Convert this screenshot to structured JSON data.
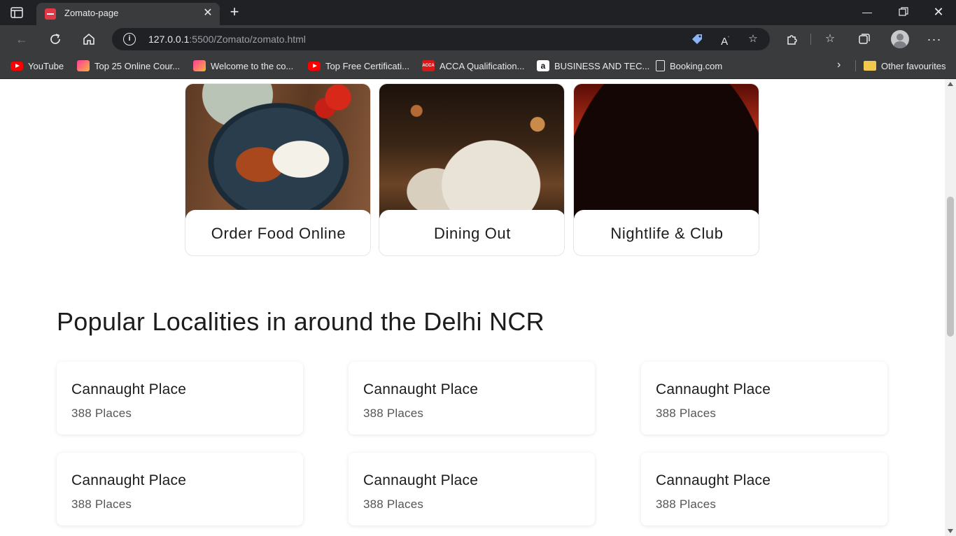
{
  "browser": {
    "tab": {
      "title": "Zomato-page"
    },
    "address": {
      "host": "127.0.0.1",
      "path": ":5500/Zomato/zomato.html"
    },
    "bookmarks": [
      {
        "label": "YouTube",
        "icon": "youtube-icon"
      },
      {
        "label": "Top 25 Online Cour...",
        "icon": "gradient-site-icon"
      },
      {
        "label": "Welcome to the co...",
        "icon": "gradient-site-icon"
      },
      {
        "label": "Top Free Certificati...",
        "icon": "youtube-icon"
      },
      {
        "label": "ACCA Qualification...",
        "icon": "acca-icon"
      },
      {
        "label": "BUSINESS AND TEC...",
        "icon": "amazon-icon"
      },
      {
        "label": "Booking.com",
        "icon": "page-icon"
      }
    ],
    "other_favourites": "Other favourites"
  },
  "icons": {
    "acca_text": "ACCA",
    "amazon_text": "a"
  },
  "page": {
    "cards": [
      {
        "label": "Order Food Online"
      },
      {
        "label": "Dining Out"
      },
      {
        "label": "Nightlife & Club"
      }
    ],
    "localities_title": "Popular Localities in around the Delhi NCR",
    "localities": [
      {
        "name": "Cannaught Place",
        "count": "388 Places"
      },
      {
        "name": "Cannaught Place",
        "count": "388 Places"
      },
      {
        "name": "Cannaught Place",
        "count": "388 Places"
      },
      {
        "name": "Cannaught Place",
        "count": "388 Places"
      },
      {
        "name": "Cannaught Place",
        "count": "388 Places"
      },
      {
        "name": "Cannaught Place",
        "count": "388 Places"
      }
    ]
  },
  "colors": {
    "brand": "#e23744",
    "chrome": "#3a3b3d",
    "page_bg": "#ffffff"
  }
}
